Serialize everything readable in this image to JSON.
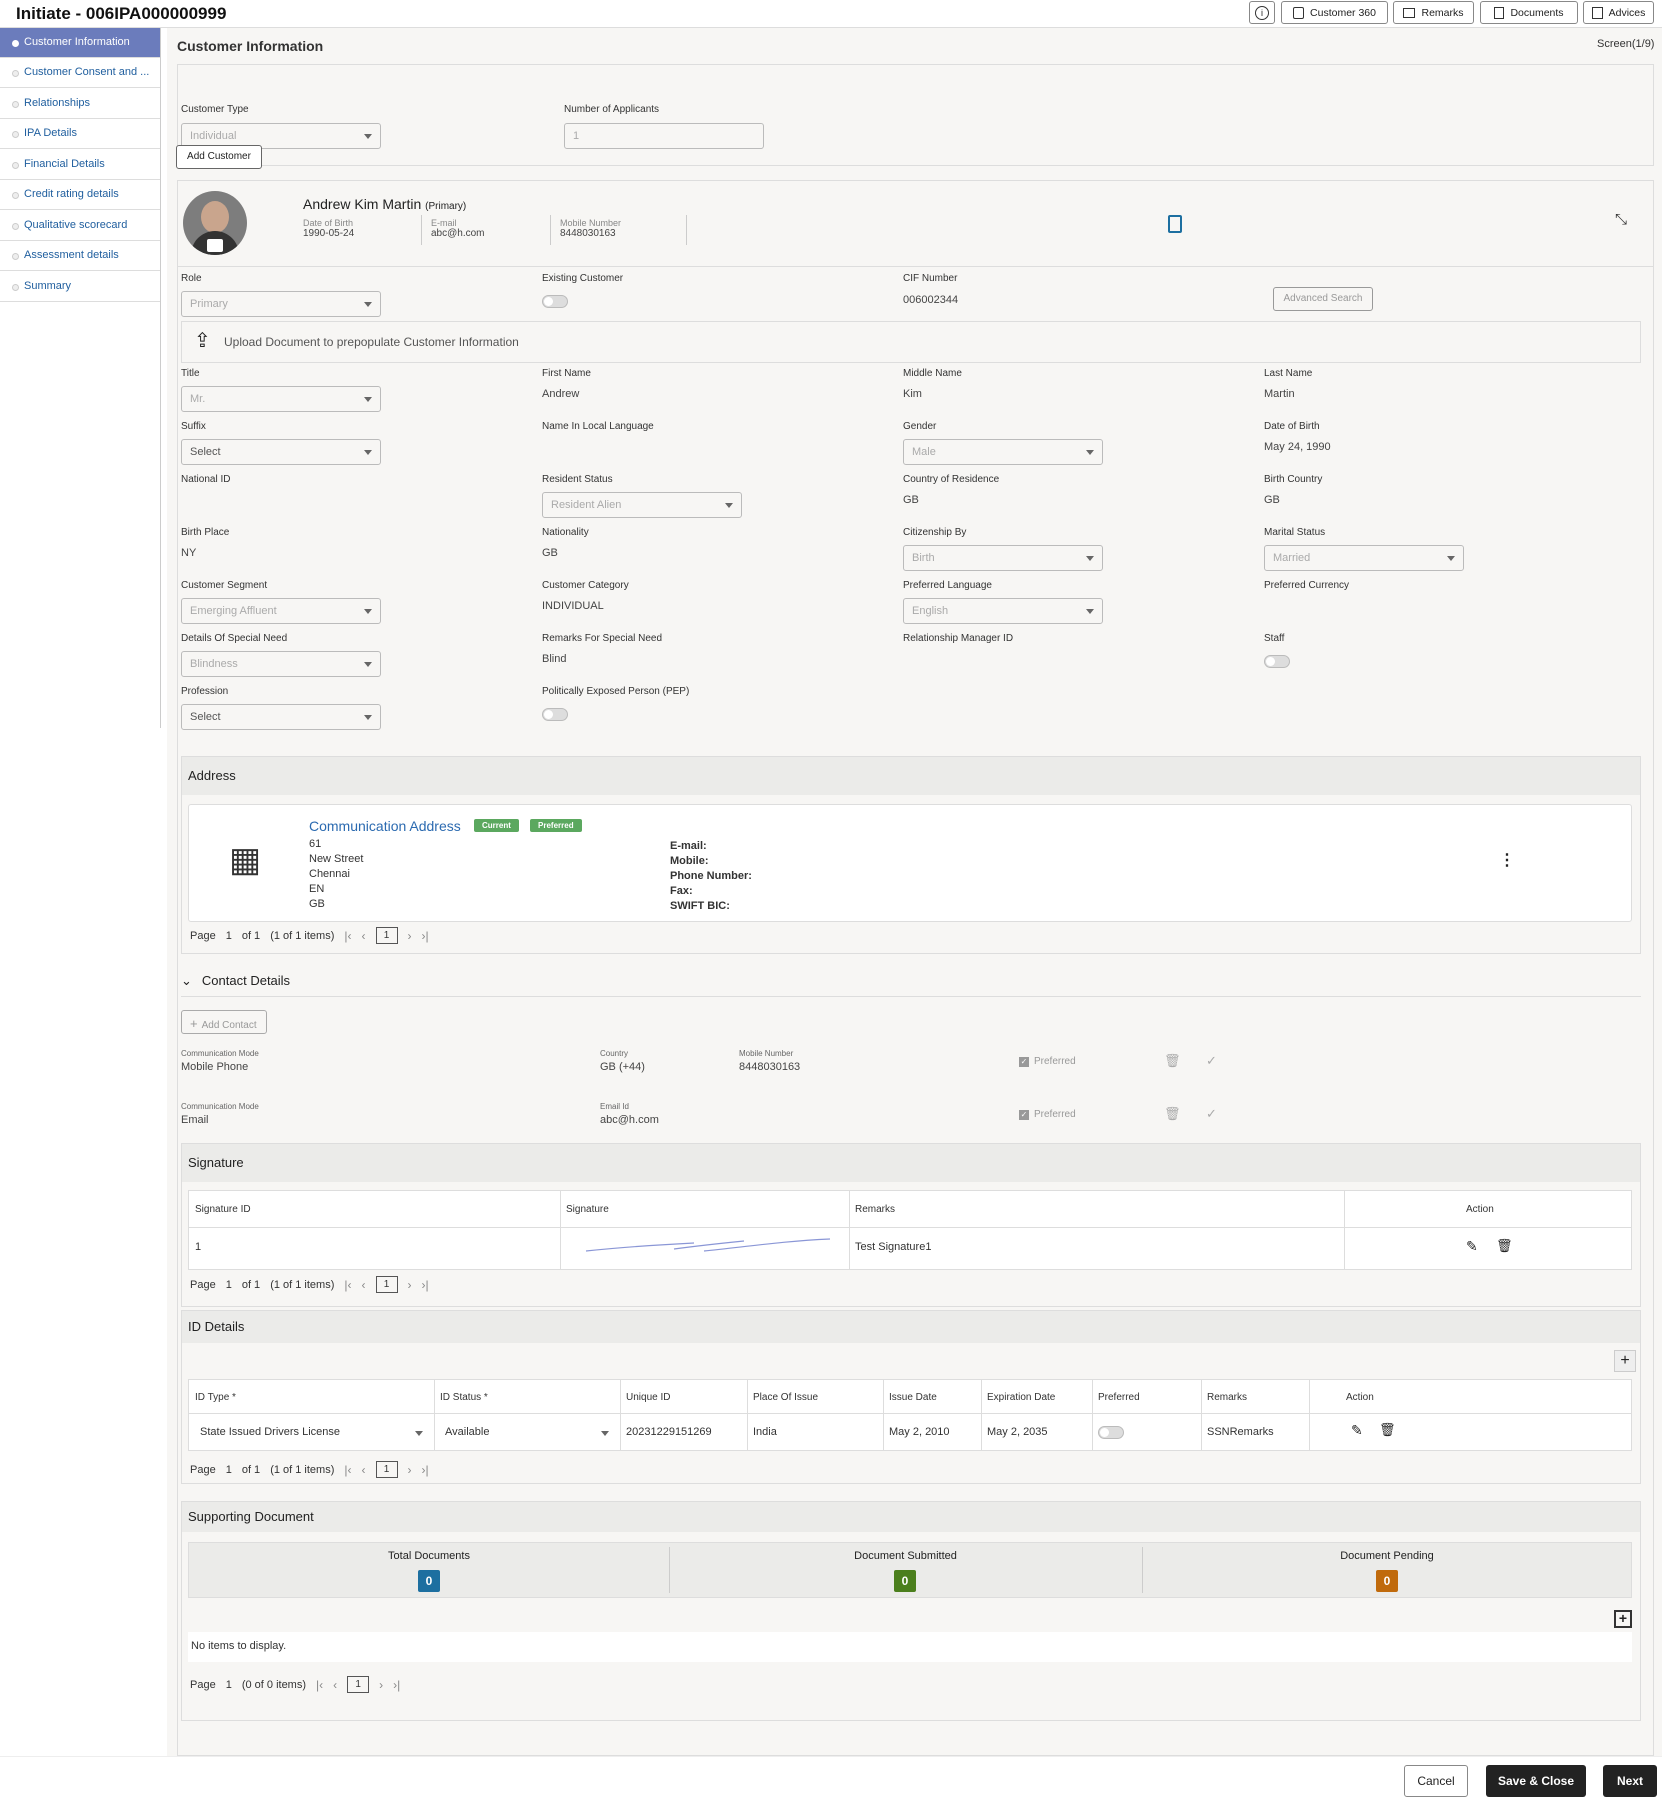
{
  "app": {
    "title": "Initiate - 006IPA000000999",
    "screen": "Screen(1/9)"
  },
  "toolbar": {
    "customer360": "Customer 360",
    "remarks": "Remarks",
    "documents": "Documents",
    "advices": "Advices"
  },
  "sidebar": {
    "items": [
      {
        "label": "Customer Information"
      },
      {
        "label": "Customer Consent and ..."
      },
      {
        "label": "Relationships"
      },
      {
        "label": "IPA Details"
      },
      {
        "label": "Financial Details"
      },
      {
        "label": "Credit rating details"
      },
      {
        "label": "Qualitative scorecard"
      },
      {
        "label": "Assessment details"
      },
      {
        "label": "Summary"
      }
    ]
  },
  "page": {
    "title": "Customer Information"
  },
  "top_form": {
    "customer_type_label": "Customer Type",
    "customer_type_value": "Individual",
    "num_applicants_label": "Number of Applicants",
    "num_applicants_value": "1",
    "add_customer": "Add Customer"
  },
  "profile": {
    "name": "Andrew Kim Martin",
    "role_tag": "(Primary)",
    "dob_label": "Date of Birth",
    "dob": "1990-05-24",
    "email_label": "E-mail",
    "email": "abc@h.com",
    "mobile_label": "Mobile Number",
    "mobile": "8448030163"
  },
  "form": {
    "role_label": "Role",
    "role_value": "Primary",
    "existing_customer_label": "Existing Customer",
    "cif_label": "CIF Number",
    "cif_value": "006002344",
    "advanced_search": "Advanced Search",
    "upload_text": "Upload Document to prepopulate Customer Information",
    "title_label": "Title",
    "title_value": "Mr.",
    "first_name_label": "First Name",
    "first_name": "Andrew",
    "middle_name_label": "Middle Name",
    "middle_name": "Kim",
    "last_name_label": "Last Name",
    "last_name": "Martin",
    "suffix_label": "Suffix",
    "suffix_value": "Select",
    "local_name_label": "Name In Local Language",
    "gender_label": "Gender",
    "gender_value": "Male",
    "dob_label": "Date of Birth",
    "dob_value": "May 24, 1990",
    "national_id_label": "National ID",
    "resident_status_label": "Resident Status",
    "resident_status_value": "Resident Alien",
    "country_residence_label": "Country of Residence",
    "country_residence": "GB",
    "birth_country_label": "Birth Country",
    "birth_country": "GB",
    "birth_place_label": "Birth Place",
    "birth_place": "NY",
    "nationality_label": "Nationality",
    "nationality": "GB",
    "citizenship_label": "Citizenship By",
    "citizenship_value": "Birth",
    "marital_label": "Marital Status",
    "marital_value": "Married",
    "segment_label": "Customer Segment",
    "segment_value": "Emerging Affluent",
    "category_label": "Customer Category",
    "category": "INDIVIDUAL",
    "language_label": "Preferred Language",
    "language_value": "English",
    "currency_label": "Preferred Currency",
    "special_need_label": "Details Of Special Need",
    "special_need_value": "Blindness",
    "remarks_need_label": "Remarks For Special Need",
    "remarks_need": "Blind",
    "rm_label": "Relationship Manager ID",
    "staff_label": "Staff",
    "profession_label": "Profession",
    "profession_value": "Select",
    "pep_label": "Politically Exposed Person (PEP)"
  },
  "address": {
    "heading": "Address",
    "title": "Communication Address",
    "badge_current": "Current",
    "badge_preferred": "Preferred",
    "lines": [
      "61",
      "New Street",
      "Chennai",
      "EN",
      "GB"
    ],
    "email_label": "E-mail:",
    "mobile_label": "Mobile:",
    "phone_label": "Phone Number:",
    "fax_label": "Fax:",
    "swift_label": "SWIFT BIC:",
    "pager": {
      "page": "Page",
      "num": "1",
      "of": "of 1",
      "items": "(1 of 1 items)",
      "box": "1"
    }
  },
  "contacts": {
    "heading": "Contact Details",
    "add": "Add Contact",
    "rows": [
      {
        "mode_label": "Communication Mode",
        "mode": "Mobile Phone",
        "c1_label": "Country",
        "c1": "GB (+44)",
        "c2_label": "Mobile Number",
        "c2": "8448030163",
        "preferred": "Preferred"
      },
      {
        "mode_label": "Communication Mode",
        "mode": "Email",
        "c1_label": "Email Id",
        "c1": "abc@h.com",
        "preferred": "Preferred"
      }
    ]
  },
  "signature": {
    "heading": "Signature",
    "cols": [
      "Signature ID",
      "Signature",
      "Remarks",
      "Action"
    ],
    "row": {
      "id": "1",
      "remarks": "Test Signature1"
    },
    "pager": {
      "page": "Page",
      "num": "1",
      "of": "of 1",
      "items": "(1 of 1 items)",
      "box": "1"
    }
  },
  "id_details": {
    "heading": "ID Details",
    "cols": [
      "ID Type *",
      "ID Status *",
      "Unique ID",
      "Place Of Issue",
      "Issue Date",
      "Expiration Date",
      "Preferred",
      "Remarks",
      "Action"
    ],
    "row": {
      "type": "State Issued Drivers License",
      "status": "Available",
      "unique": "20231229151269",
      "place": "India",
      "issue": "May 2, 2010",
      "expiry": "May 2, 2035",
      "remarks": "SSNRemarks"
    },
    "pager": {
      "page": "Page",
      "num": "1",
      "of": "of 1",
      "items": "(1 of 1 items)",
      "box": "1"
    }
  },
  "supporting": {
    "heading": "Supporting Document",
    "total_label": "Total Documents",
    "total": "0",
    "submitted_label": "Document Submitted",
    "submitted": "0",
    "pending_label": "Document Pending",
    "pending": "0",
    "empty": "No items to display.",
    "pager": {
      "page": "Page",
      "num": "1",
      "items": "(0 of 0 items)",
      "box": "1"
    }
  },
  "footer": {
    "cancel": "Cancel",
    "save_close": "Save & Close",
    "next": "Next"
  },
  "colors": {
    "accent": "#6b7cbc",
    "total": "#1d6fa0",
    "submitted": "#4b7f1d",
    "pending": "#c06a0c",
    "badge": "#5ba85f"
  }
}
